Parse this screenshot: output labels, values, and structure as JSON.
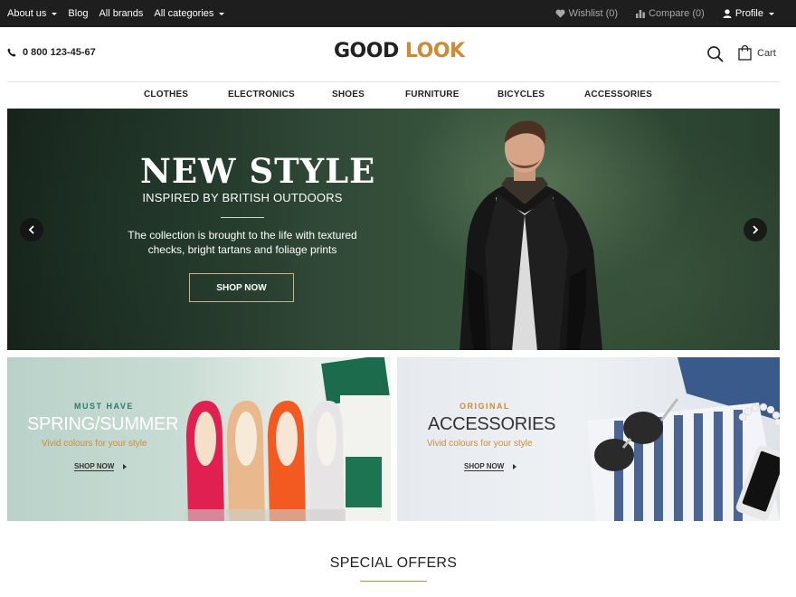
{
  "topbar": {
    "about": "About us",
    "blog": "Blog",
    "brands": "All brands",
    "categories": "All categories",
    "wishlist": "Wishlist (0)",
    "compare": "Compare (0)",
    "profile": "Profile"
  },
  "header": {
    "phone": "0 800 123-45-67",
    "logo_part1": "GOOD",
    "logo_part2": "LOOK",
    "cart": "Cart"
  },
  "nav": [
    "CLOTHES",
    "ELECTRONICS",
    "SHOES",
    "FURNITURE",
    "BICYCLES",
    "ACCESSORIES"
  ],
  "hero": {
    "title": "NEW STYLE",
    "subtitle": "INSPIRED BY BRITISH OUTDOORS",
    "description": "The collection is brought to the life with textured checks, bright tartans and foliage prints",
    "cta": "SHOP NOW"
  },
  "promos": [
    {
      "kicker": "MUST HAVE",
      "title": "SPRING/SUMMER",
      "tagline": "Vivid colours for your style",
      "link": "SHOP NOW"
    },
    {
      "kicker": "ORIGINAL",
      "title": "ACCESSORIES",
      "tagline": "Vivid colours for your style",
      "link": "SHOP NOW"
    }
  ],
  "section": {
    "title": "SPECIAL OFFERS"
  },
  "colors": {
    "accent": "#d08a35",
    "topbar": "#1e1e1e",
    "teal": "#2b7d6b"
  }
}
